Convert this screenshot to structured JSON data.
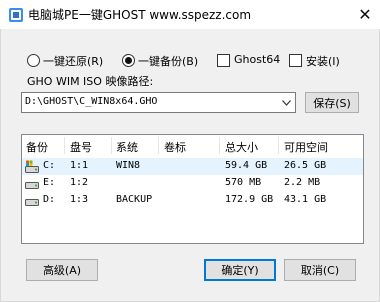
{
  "window": {
    "title": "电脑城PE一键GHOST   www.sspezz.com",
    "close_glyph": "✕"
  },
  "options": {
    "restore_label": "一键还原(R)",
    "backup_label": "一键备份(B)",
    "ghost64_label": "Ghost64",
    "install_label": "安装(I)",
    "selected_mode": "backup"
  },
  "path": {
    "label": "GHO WIM ISO 映像路径:",
    "value": "D:\\GHOST\\C_WIN8x64.GHO",
    "save_label": "保存(S)"
  },
  "table": {
    "columns": [
      "备份",
      "盘号",
      "系统",
      "卷标",
      "总大小",
      "可用空间"
    ],
    "rows": [
      {
        "drive": "C:",
        "disk": "1:1",
        "system": "WIN8",
        "label": "",
        "total": "59.4 GB",
        "free": "26.5 GB",
        "icon": "system-drive-icon",
        "selected": true
      },
      {
        "drive": "E:",
        "disk": "1:2",
        "system": "",
        "label": "",
        "total": "570 MB",
        "free": "2.2 MB",
        "icon": "drive-icon",
        "selected": false
      },
      {
        "drive": "D:",
        "disk": "1:3",
        "system": "BACKUP",
        "label": "",
        "total": "172.9 GB",
        "free": "43.1 GB",
        "icon": "drive-icon",
        "selected": false
      }
    ]
  },
  "buttons": {
    "advanced_label": "高级(A)",
    "ok_label": "确定(Y)",
    "cancel_label": "取消(C)"
  },
  "colors": {
    "accent": "#0078d7",
    "selected_row": "#e5f3ff"
  }
}
